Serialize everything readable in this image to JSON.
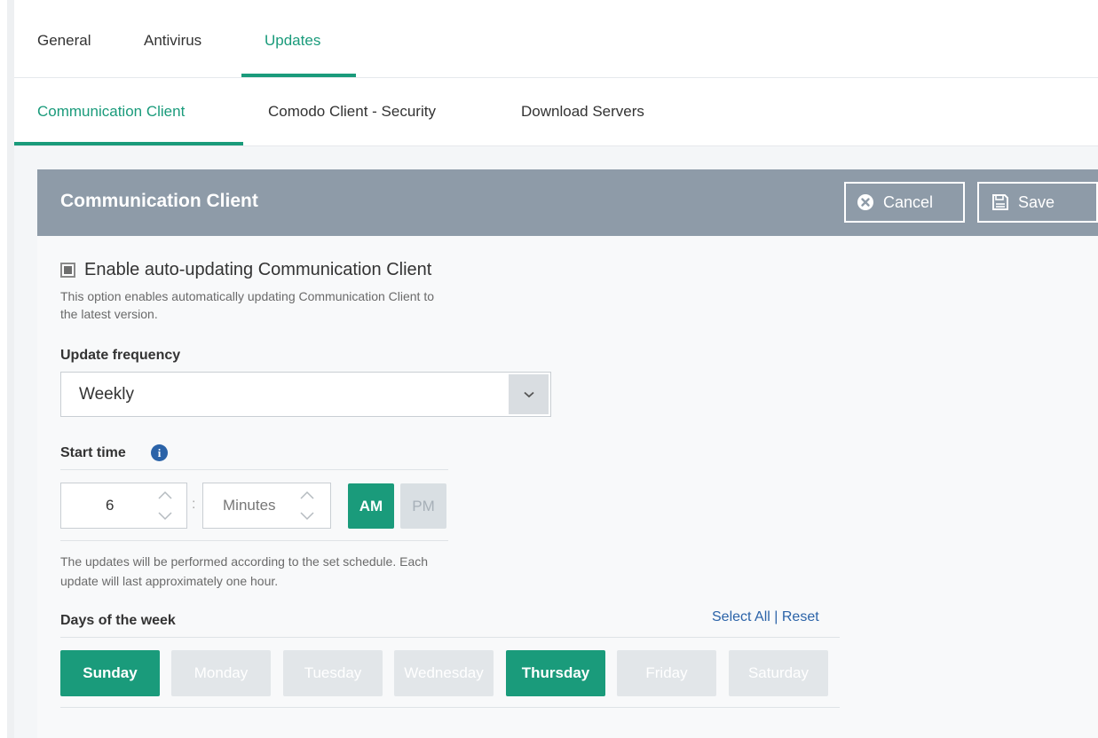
{
  "top_tabs": [
    {
      "label": "General",
      "active": false
    },
    {
      "label": "Antivirus",
      "active": false
    },
    {
      "label": "Updates",
      "active": true
    }
  ],
  "sub_tabs": [
    {
      "label": "Communication Client",
      "active": true
    },
    {
      "label": "Comodo Client - Security",
      "active": false
    },
    {
      "label": "Download Servers",
      "active": false
    }
  ],
  "panel": {
    "title": "Communication Client",
    "cancel_label": "Cancel",
    "save_label": "Save"
  },
  "auto_update": {
    "label": "Enable auto-updating Communication Client",
    "checked": true,
    "help_line1": "This option enables automatically updating Communication Client to",
    "help_line2": "the latest version."
  },
  "frequency": {
    "label": "Update frequency",
    "value": "Weekly"
  },
  "start_time": {
    "label": "Start time",
    "hour": "6",
    "minutes_placeholder": "Minutes",
    "am_label": "AM",
    "pm_label": "PM",
    "selected": "AM",
    "note_line1": "The updates will be performed according to the set schedule. Each",
    "note_line2": "update will last approximately one hour."
  },
  "days": {
    "label": "Days of the week",
    "select_all": "Select All",
    "separator": "|",
    "reset": "Reset",
    "items": [
      {
        "label": "Sunday",
        "selected": true
      },
      {
        "label": "Monday",
        "selected": false
      },
      {
        "label": "Tuesday",
        "selected": false
      },
      {
        "label": "Wednesday",
        "selected": false
      },
      {
        "label": "Thursday",
        "selected": true
      },
      {
        "label": "Friday",
        "selected": false
      },
      {
        "label": "Saturday",
        "selected": false
      }
    ]
  },
  "colors": {
    "accent": "#1a9b7b",
    "header_bg": "#8e9ba8",
    "link": "#2b63a8",
    "inactive_day": "#e2e6e9"
  },
  "icons": {
    "cancel": "close-circle-icon",
    "save": "save-icon",
    "dropdown": "chevron-down-icon",
    "info": "info-icon"
  }
}
